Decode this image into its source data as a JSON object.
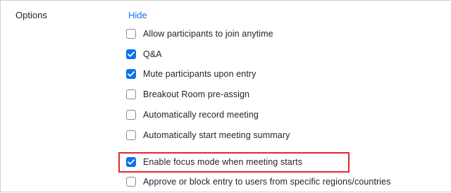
{
  "section": {
    "label": "Options",
    "toggle_label": "Hide"
  },
  "options": [
    {
      "label": "Allow participants to join anytime",
      "checked": false
    },
    {
      "label": "Q&A",
      "checked": true
    },
    {
      "label": "Mute participants upon entry",
      "checked": true
    },
    {
      "label": "Breakout Room pre-assign",
      "checked": false
    },
    {
      "label": "Automatically record meeting",
      "checked": false
    },
    {
      "label": "Automatically start meeting summary",
      "checked": false
    },
    {
      "label": "Enable focus mode when meeting starts",
      "checked": true,
      "highlighted": true
    },
    {
      "label": "Approve or block entry to users from specific regions/countries",
      "checked": false
    }
  ],
  "colors": {
    "accent": "#0e72ed",
    "highlight": "#e0282e",
    "text": "#232333"
  }
}
